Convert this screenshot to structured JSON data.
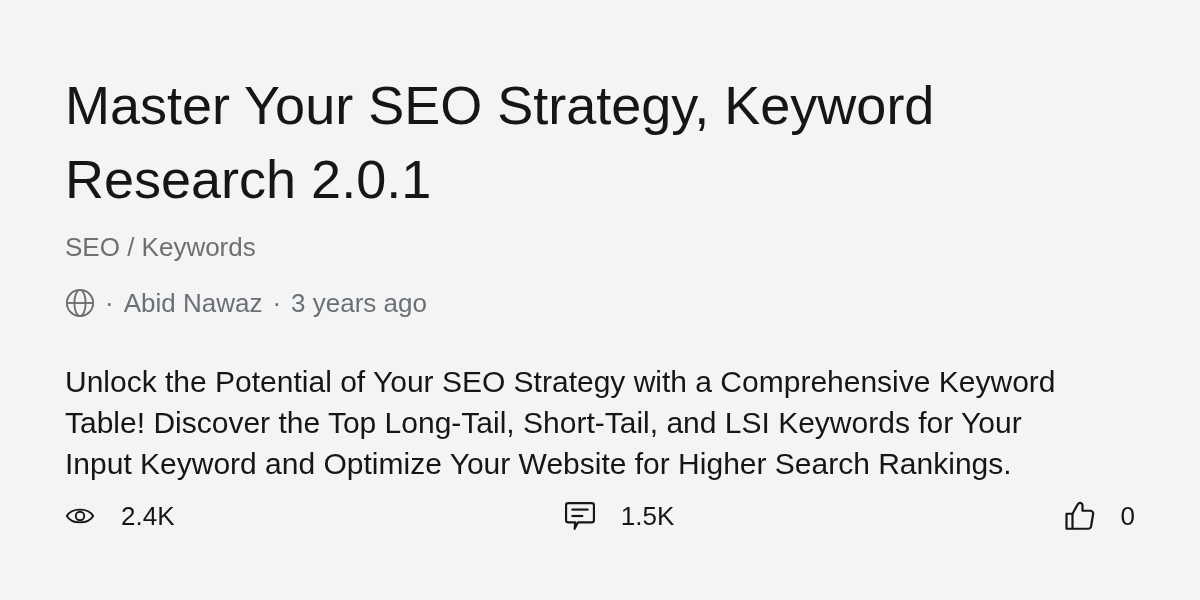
{
  "title": "Master Your SEO Strategy, Keyword Research 2.0.1",
  "category": "SEO / Keywords",
  "meta": [
    "·",
    "Abid Nawaz",
    "·",
    "3 years ago"
  ],
  "description": "Unlock the Potential of Your SEO Strategy with a Comprehensive Keyword Table! Discover the Top Long-Tail, Short-Tail, and LSI Keywords for Your Input Keyword and Optimize Your Website for Higher Search Rankings.",
  "stats": [
    {
      "kind": "views",
      "count": "2.4K"
    },
    {
      "kind": "comments",
      "count": "1.5K"
    },
    {
      "kind": "likes",
      "count": "0"
    }
  ]
}
